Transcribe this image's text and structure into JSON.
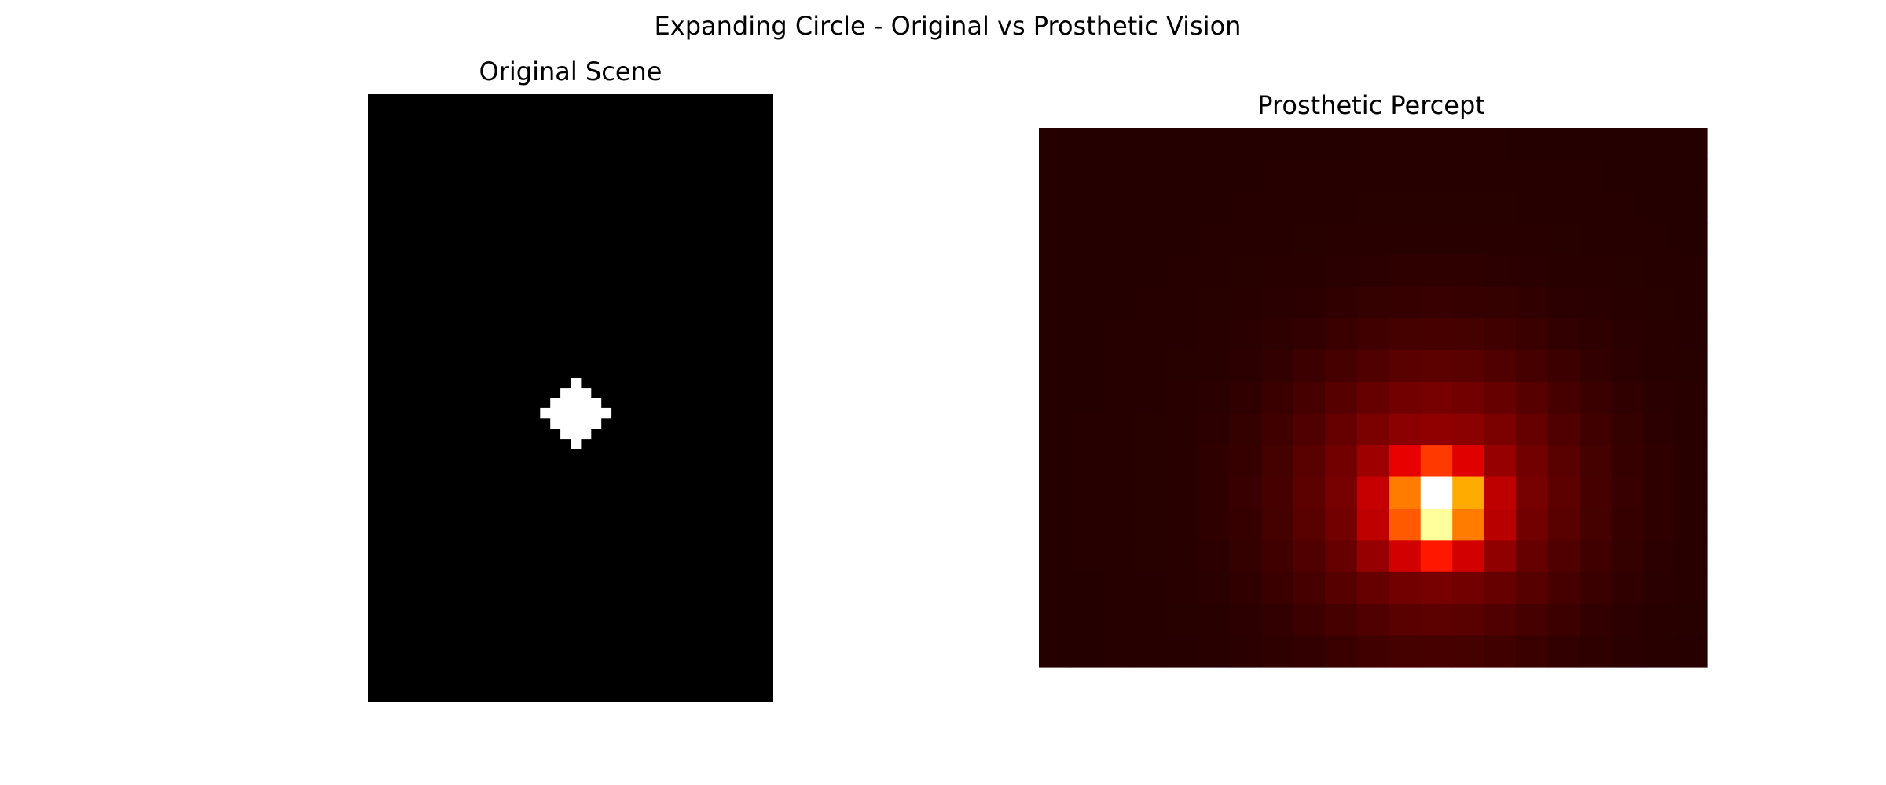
{
  "figure": {
    "title": "Expanding Circle - Original vs Prosthetic Vision"
  },
  "chart_data": [
    {
      "type": "heatmap",
      "title": "Original Scene",
      "colormap": "gray",
      "background_color": "#000000",
      "grid_cols": 40,
      "grid_rows": 60,
      "vmin": 0,
      "vmax": 1,
      "white_pixels": [
        [
          20,
          28
        ],
        [
          19,
          29
        ],
        [
          20,
          29
        ],
        [
          21,
          29
        ],
        [
          18,
          30
        ],
        [
          19,
          30
        ],
        [
          20,
          30
        ],
        [
          21,
          30
        ],
        [
          22,
          30
        ],
        [
          17,
          31
        ],
        [
          18,
          31
        ],
        [
          19,
          31
        ],
        [
          20,
          31
        ],
        [
          21,
          31
        ],
        [
          22,
          31
        ],
        [
          23,
          31
        ],
        [
          18,
          32
        ],
        [
          19,
          32
        ],
        [
          20,
          32
        ],
        [
          21,
          32
        ],
        [
          22,
          32
        ],
        [
          19,
          33
        ],
        [
          20,
          33
        ],
        [
          21,
          33
        ],
        [
          20,
          34
        ]
      ],
      "axes_visible": false
    },
    {
      "type": "heatmap",
      "title": "Prosthetic Percept",
      "colormap": "hot",
      "grid_cols": 21,
      "grid_rows": 17,
      "peak_cell": [
        12,
        11
      ],
      "peak_value": 1.0,
      "hotspot_cells": [
        {
          "col": 12,
          "row": 11,
          "value": 1.0
        },
        {
          "col": 12,
          "row": 12,
          "value": 0.9
        },
        {
          "col": 11,
          "row": 11,
          "value": 0.55
        },
        {
          "col": 11,
          "row": 12,
          "value": 0.5
        },
        {
          "col": 13,
          "row": 11,
          "value": 0.62
        },
        {
          "col": 13,
          "row": 12,
          "value": 0.55
        },
        {
          "col": 12,
          "row": 10,
          "value": 0.45
        },
        {
          "col": 12,
          "row": 13,
          "value": 0.4
        },
        {
          "col": 11,
          "row": 10,
          "value": 0.33
        },
        {
          "col": 13,
          "row": 10,
          "value": 0.32
        },
        {
          "col": 11,
          "row": 13,
          "value": 0.3
        },
        {
          "col": 13,
          "row": 13,
          "value": 0.3
        },
        {
          "col": 10,
          "row": 11,
          "value": 0.28
        },
        {
          "col": 10,
          "row": 12,
          "value": 0.27
        },
        {
          "col": 14,
          "row": 11,
          "value": 0.27
        },
        {
          "col": 14,
          "row": 12,
          "value": 0.26
        },
        {
          "col": 10,
          "row": 10,
          "value": 0.22
        },
        {
          "col": 14,
          "row": 10,
          "value": 0.21
        },
        {
          "col": 10,
          "row": 13,
          "value": 0.21
        },
        {
          "col": 14,
          "row": 13,
          "value": 0.2
        }
      ],
      "background_value": 0.04,
      "axes_visible": false
    }
  ]
}
